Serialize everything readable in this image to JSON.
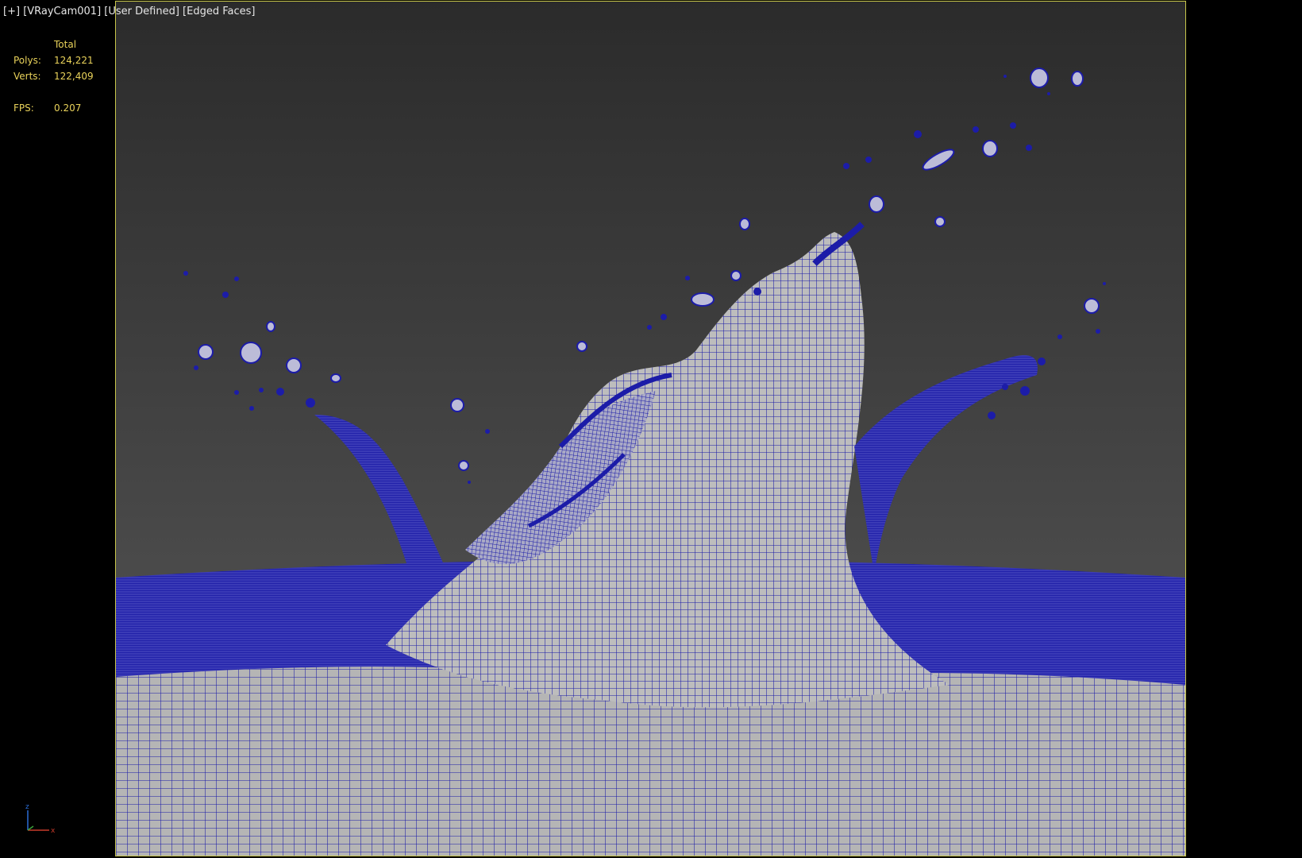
{
  "viewport": {
    "labels": {
      "menu": "[+]",
      "camera": "[VRayCam001]",
      "shading_mode": "[User Defined]",
      "display_mode": "[Edged Faces]"
    },
    "stats": {
      "column_header": "Total",
      "polys_label": "Polys:",
      "polys_value": "124,221",
      "verts_label": "Verts:",
      "verts_value": "122,409",
      "fps_label": "FPS:",
      "fps_value": "0.207"
    },
    "axis": {
      "z": "z",
      "x": "x"
    },
    "colors": {
      "background_top": "#2e2e2e",
      "background_bottom": "#5a5a5a",
      "wire": "#1c1ca8",
      "surface": "#bdbdbd",
      "stats_text": "#e9d25a",
      "frame": "#c8c64a"
    }
  }
}
